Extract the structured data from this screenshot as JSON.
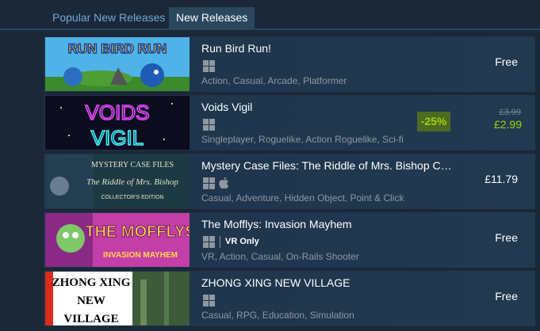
{
  "tabs": {
    "popular": "Popular New Releases",
    "new": "New Releases"
  },
  "games": [
    {
      "name": "Run Bird Run!",
      "tags": "Action, Casual, Arcade, Platformer",
      "price": "Free",
      "thumb_text": "RUN BIRD RUN"
    },
    {
      "name": "Voids Vigil",
      "tags": "Singleplayer, Roguelike, Action Roguelike, Sci-fi",
      "discount": "-25%",
      "original_price": "£3.99",
      "final_price": "£2.99",
      "thumb_line1": "VOIDS",
      "thumb_line2": "VIGIL"
    },
    {
      "name": "Mystery Case Files: The Riddle of Mrs. Bishop C…",
      "tags": "Casual, Adventure, Hidden Object, Point & Click",
      "price": "£11.79",
      "thumb_line1": "MYSTERY CASE FILES",
      "thumb_line2": "The Riddle of Mrs. Bishop",
      "thumb_line3": "COLLECTOR'S EDITION"
    },
    {
      "name": "The Mofflys: Invasion Mayhem",
      "tags": "VR, Action, Casual, On-Rails Shooter",
      "price": "Free",
      "vr_label": "VR Only",
      "thumb_line1": "THE MOFFLYS",
      "thumb_line2": "INVASION MAYHEM"
    },
    {
      "name": "ZHONG XING NEW VILLAGE",
      "tags": "Casual, RPG, Education, Simulation",
      "price": "Free",
      "thumb_line1": "ZHONG XING",
      "thumb_line2": "NEW",
      "thumb_line3": "VILLAGE"
    }
  ]
}
